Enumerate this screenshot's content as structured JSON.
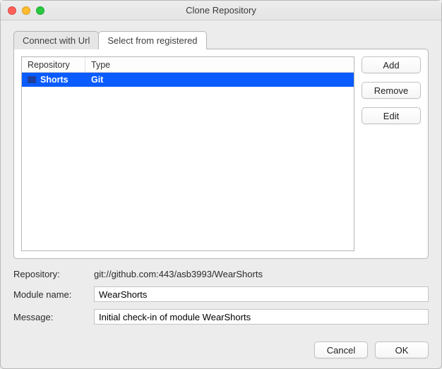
{
  "window": {
    "title": "Clone Repository"
  },
  "tabs": {
    "connect": "Connect with Url",
    "select": "Select from registered"
  },
  "table": {
    "headers": {
      "repo": "Repository",
      "type": "Type"
    },
    "rows": [
      {
        "repo": "Shorts",
        "type": "Git",
        "selected": true
      }
    ]
  },
  "side_buttons": {
    "add": "Add",
    "remove": "Remove",
    "edit": "Edit"
  },
  "form": {
    "repo_label": "Repository:",
    "repo_value": "git://github.com:443/asb3993/WearShorts",
    "module_label": "Module name:",
    "module_value": "WearShorts",
    "message_label": "Message:",
    "message_value": "Initial check-in of module WearShorts"
  },
  "footer": {
    "cancel": "Cancel",
    "ok": "OK"
  }
}
